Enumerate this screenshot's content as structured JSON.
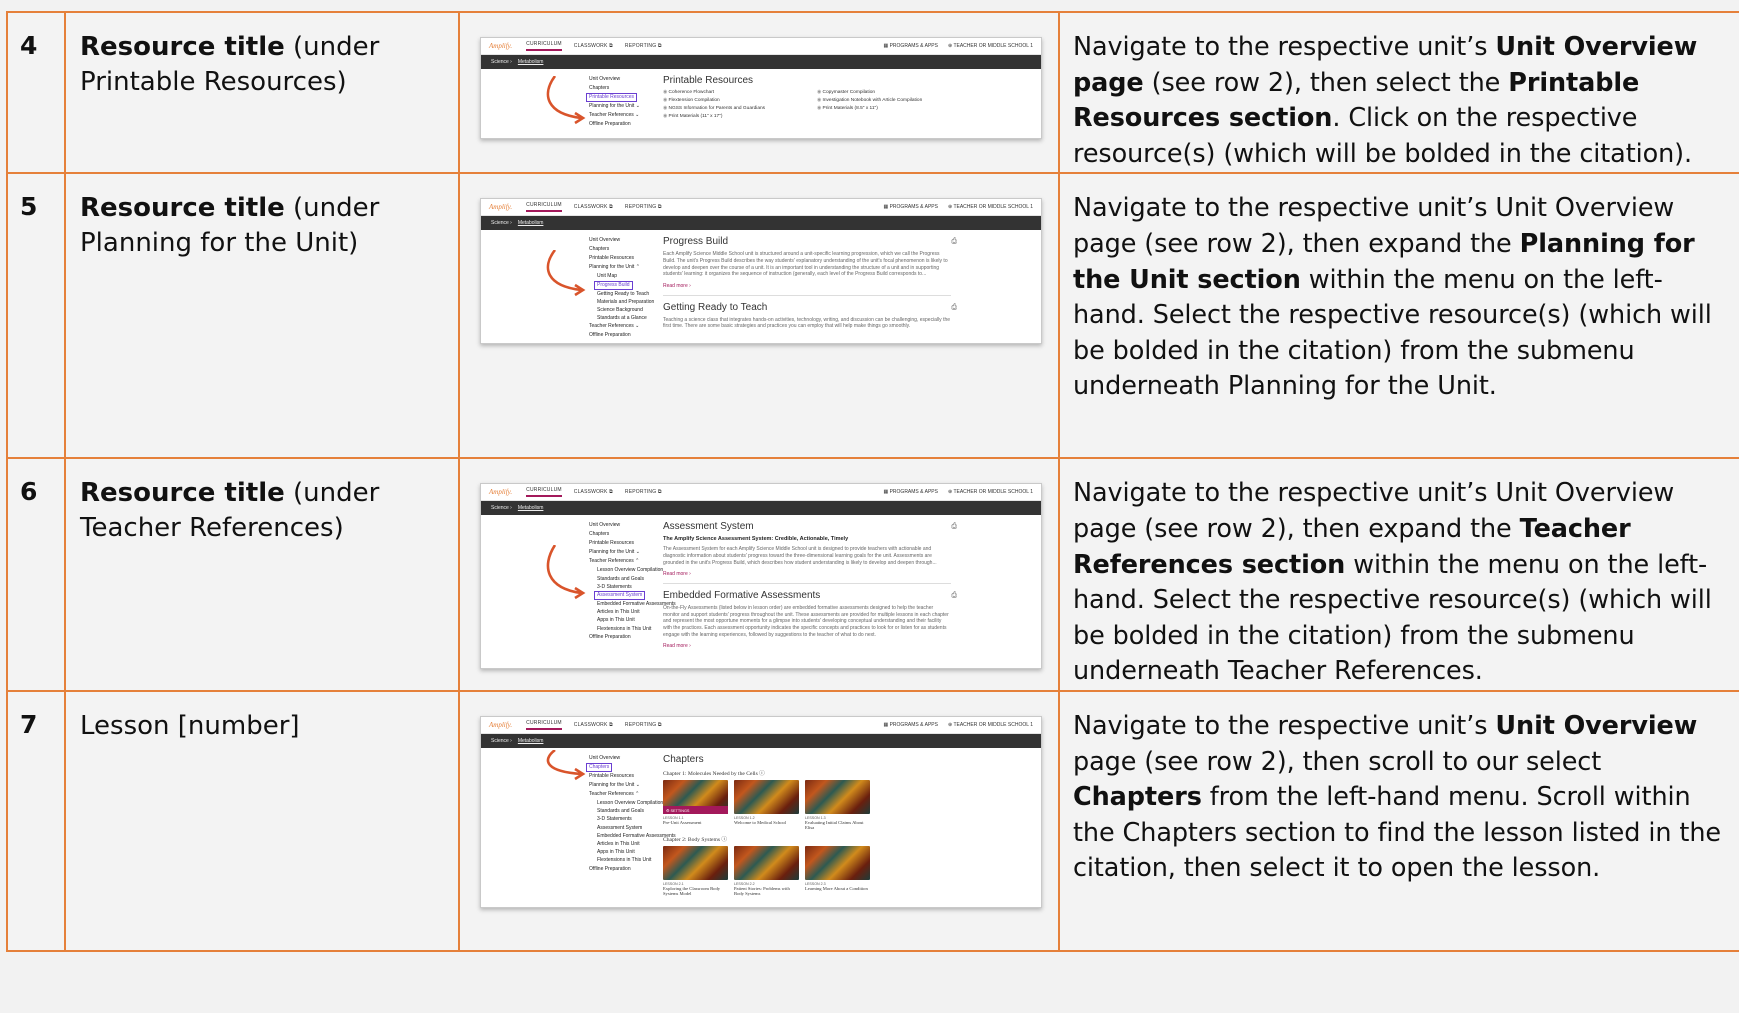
{
  "rows": [
    {
      "num": "4",
      "cite_bold": "Resource title",
      "cite_rest": " (under Printable Resources)",
      "nav": [
        {
          "t": "Navigate to the respective unit’s ",
          "b": false
        },
        {
          "t": "Unit Overview page",
          "b": true
        },
        {
          "t": " (see row 2), then select the ",
          "b": false
        },
        {
          "t": "Printable Resources section",
          "b": true
        },
        {
          "t": ". Click on the respective resource(s) (which will be bolded in the citation).",
          "b": false
        }
      ],
      "shot": {
        "logo": "Amplify.",
        "tabs": [
          "CURRICULUM",
          "CLASSWORK ⧉",
          "REPORTING ⧉"
        ],
        "right": [
          "▦ PROGRAMS & APPS",
          "⊕ TEACHER OR MIDDLE SCHOOL 1"
        ],
        "crumb": "Science  ›",
        "crumb_link": "Metabolism",
        "side": [
          {
            "t": "Unit Overview"
          },
          {
            "t": "Chapters"
          },
          {
            "t": "Printable Resources",
            "hl": true
          },
          {
            "t": "Planning for the Unit ⌄"
          },
          {
            "t": "Teacher References ⌄"
          },
          {
            "t": "Offline Preparation"
          }
        ],
        "heading": "Printable Resources",
        "items": [
          "Coherence Flowchart",
          "Copymaster Compilation",
          "Flextension Compilation",
          "Investigation Notebook with Article Compilation",
          "NGSS Information for Parents and Guardians",
          "Print Materials (8.5\" x 11\")",
          "Print Materials (11\" x 17\")"
        ]
      }
    },
    {
      "num": "5",
      "cite_bold": "Resource title",
      "cite_rest": " (under Planning for the Unit)",
      "nav": [
        {
          "t": "Navigate to the respective unit’s Unit Overview page (see row 2), then expand the ",
          "b": false
        },
        {
          "t": "Planning for the Unit section",
          "b": true
        },
        {
          "t": " within the menu on the left-hand. Select the respective resource(s) (which will be bolded in the citation) from the submenu underneath Planning for the Unit.",
          "b": false
        }
      ],
      "shot": {
        "logo": "Amplify.",
        "tabs": [
          "CURRICULUM",
          "CLASSWORK ⧉",
          "REPORTING ⧉"
        ],
        "right": [
          "▦ PROGRAMS & APPS",
          "⊕ TEACHER OR MIDDLE SCHOOL 1"
        ],
        "crumb": "Science  ›",
        "crumb_link": "Metabolism",
        "side": [
          {
            "t": "Unit Overview"
          },
          {
            "t": "Chapters"
          },
          {
            "t": "Printable Resources"
          },
          {
            "t": "Planning for the Unit ⌃"
          },
          {
            "t": "Unit Map",
            "sub": true
          },
          {
            "t": "Progress Build",
            "sub": true,
            "hl": true
          },
          {
            "t": "Getting Ready to Teach",
            "sub": true
          },
          {
            "t": "Materials and Preparation",
            "sub": true
          },
          {
            "t": "Science Background",
            "sub": true
          },
          {
            "t": "Standards at a Glance",
            "sub": true
          },
          {
            "t": "Teacher References ⌄"
          },
          {
            "t": "Offline Preparation"
          }
        ],
        "heading": "Progress Build",
        "para": "Each Amplify Science Middle School unit is structured around a unit-specific learning progression, which we call the Progress Build. The unit's Progress Build describes the way students' explanatory understanding of the unit's focal phenomenon is likely to develop and deepen over the course of a unit. It is an important tool in understanding the structure of a unit and in supporting students' learning: it organizes the sequence of instruction (generally, each level of the Progress Build corresponds to...",
        "more": "Read more  ›",
        "heading2": "Getting Ready to Teach",
        "para2": "Teaching a science class that integrates hands-on activities, technology, writing, and discussion can be challenging, especially the first time. There are some basic strategies and practices you can employ that will help make things go smoothly."
      }
    },
    {
      "num": "6",
      "cite_bold": "Resource title",
      "cite_rest": " (under Teacher References)",
      "nav": [
        {
          "t": "Navigate to the respective unit’s Unit Overview page (see row 2), then expand the ",
          "b": false
        },
        {
          "t": "Teacher References section",
          "b": true
        },
        {
          "t": " within the menu on the left-hand. Select the respective resource(s) (which will be bolded in the citation) from the submenu underneath Teacher References.",
          "b": false
        }
      ],
      "shot": {
        "logo": "Amplify.",
        "tabs": [
          "CURRICULUM",
          "CLASSWORK ⧉",
          "REPORTING ⧉"
        ],
        "right": [
          "▦ PROGRAMS & APPS",
          "⊕ TEACHER OR MIDDLE SCHOOL 1"
        ],
        "crumb": "Science  ›",
        "crumb_link": "Metabolism",
        "side": [
          {
            "t": "Unit Overview"
          },
          {
            "t": "Chapters"
          },
          {
            "t": "Printable Resources"
          },
          {
            "t": "Planning for the Unit ⌄"
          },
          {
            "t": "Teacher References ⌃"
          },
          {
            "t": "Lesson Overview Compilation",
            "sub": true
          },
          {
            "t": "Standards and Goals",
            "sub": true
          },
          {
            "t": "3-D Statements",
            "sub": true
          },
          {
            "t": "Assessment System",
            "sub": true,
            "hl": true
          },
          {
            "t": "Embedded Formative Assessments",
            "sub": true
          },
          {
            "t": "Articles in This Unit",
            "sub": true
          },
          {
            "t": "Apps in This Unit",
            "sub": true
          },
          {
            "t": "Flextensions in This Unit",
            "sub": true
          },
          {
            "t": "Offline Preparation"
          }
        ],
        "heading": "Assessment System",
        "sub": "The Amplify Science Assessment System: Credible, Actionable, Timely",
        "para": "The Assessment System for each Amplify Science Middle School unit is designed to provide teachers with actionable and diagnostic information about students' progress toward the three-dimensional learning goals for the unit. Assessments are grounded in the unit's Progress Build, which describes how student understanding is likely to develop and deepen through...",
        "more": "Read more  ›",
        "heading2": "Embedded Formative Assessments",
        "para2": "On-the-Fly Assessments (listed below in lesson order) are embedded formative assessments designed to help the teacher monitor and support students' progress throughout the unit. These assessments are provided for multiple lessons in each chapter and represent the most opportune moments for a glimpse into students' developing conceptual understanding and their facility with the practices. Each assessment opportunity indicates the specific concepts and practices to look for or listen for as students engage with the learning experiences, followed by suggestions to the teacher of what to do next.",
        "more2": "Read more  ›"
      }
    },
    {
      "num": "7",
      "cite_bold": "",
      "cite_rest": "Lesson [number]",
      "nav": [
        {
          "t": "Navigate to the respective unit’s ",
          "b": false
        },
        {
          "t": "Unit Overview",
          "b": true
        },
        {
          "t": " page (see row 2), then scroll to our select ",
          "b": false
        },
        {
          "t": "Chapters",
          "b": true
        },
        {
          "t": " from the left-hand menu. Scroll within the Chapters section to find the lesson listed in the citation, then select it to open the lesson.",
          "b": false
        }
      ],
      "shot": {
        "logo": "Amplify.",
        "tabs": [
          "CURRICULUM",
          "CLASSWORK ⧉",
          "REPORTING ⧉"
        ],
        "right": [
          "▦ PROGRAMS & APPS",
          "⊕ TEACHER OR MIDDLE SCHOOL 1"
        ],
        "crumb": "Science  ›",
        "crumb_link": "Metabolism",
        "side": [
          {
            "t": "Unit Overview"
          },
          {
            "t": "Chapters",
            "hl": true
          },
          {
            "t": "Printable Resources"
          },
          {
            "t": "Planning for the Unit ⌄"
          },
          {
            "t": "Teacher References ⌃"
          },
          {
            "t": "Lesson Overview Compilation",
            "sub": true
          },
          {
            "t": "Standards and Goals",
            "sub": true
          },
          {
            "t": "3-D Statements",
            "sub": true
          },
          {
            "t": "Assessment System",
            "sub": true
          },
          {
            "t": "Embedded Formative Assessments",
            "sub": true
          },
          {
            "t": "Articles in This Unit",
            "sub": true
          },
          {
            "t": "Apps in This Unit",
            "sub": true
          },
          {
            "t": "Flextensions in This Unit",
            "sub": true
          },
          {
            "t": "Offline Preparation"
          }
        ],
        "heading": "Chapters",
        "ch1": "Chapter 1: Molecules Needed by the Cells  ⓘ",
        "ch1_lessons": [
          {
            "n": "LESSON 1.1",
            "t": "Pre-Unit Assessment",
            "sel": true
          },
          {
            "n": "LESSON 1.2",
            "t": "Welcome to Medical School"
          },
          {
            "n": "LESSON 1.3",
            "t": "Evaluating Initial Claims About Elisa"
          }
        ],
        "settings": "⚙ SETTINGS",
        "ch2": "Chapter 2: Body Systems  ⓘ",
        "ch2_lessons": [
          {
            "n": "LESSON 2.1",
            "t": "Exploring the Classroom Body Systems Model"
          },
          {
            "n": "LESSON 2.2",
            "t": "Patient Stories: Problems with Body Systems"
          },
          {
            "n": "LESSON 2.3",
            "t": "Learning More About a Condition"
          }
        ]
      }
    }
  ],
  "colors": {
    "border": "#e5803a",
    "accent": "#a3195b",
    "highlight": "#6a3fd1",
    "arrow": "#d9542b"
  }
}
